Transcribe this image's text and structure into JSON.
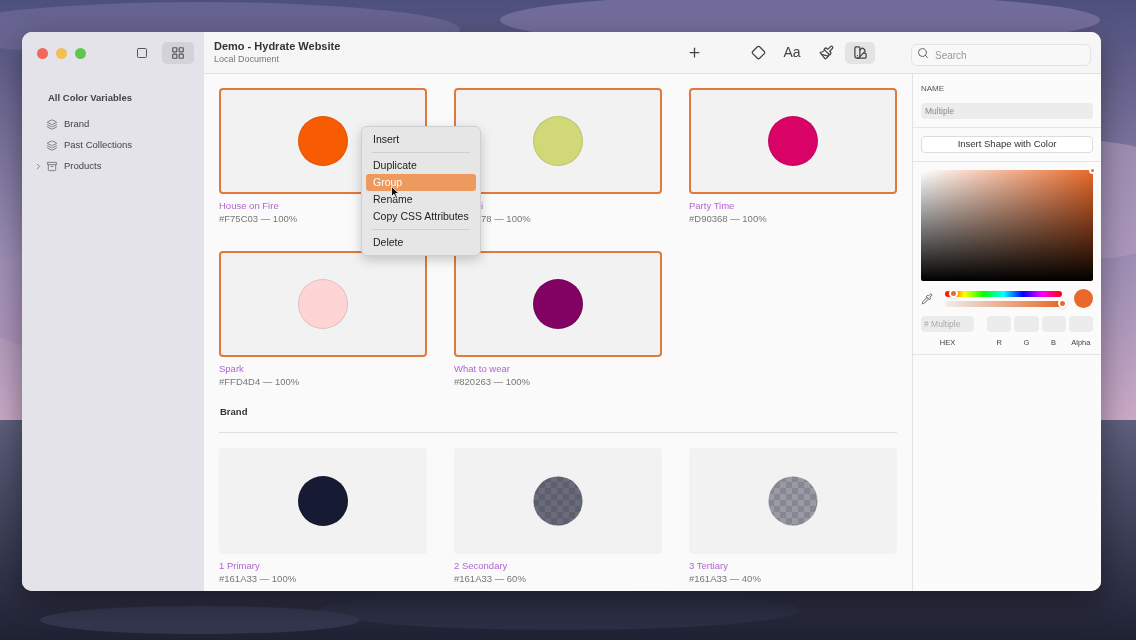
{
  "window": {
    "title": "Demo - Hydrate Website",
    "subtitle": "Local Document"
  },
  "view_toggle": [
    {
      "kind": "single",
      "selected": false
    },
    {
      "kind": "grid",
      "selected": true
    }
  ],
  "sidebar": {
    "heading": "All Color Variables",
    "items": [
      {
        "label": "Brand",
        "kind": "collection"
      },
      {
        "label": "Past Collections",
        "kind": "collection"
      },
      {
        "label": "Products",
        "kind": "folder",
        "expanded": false
      }
    ]
  },
  "toolbar": [
    {
      "kind": "add",
      "selected": false
    },
    {
      "kind": "shape",
      "selected": false
    },
    {
      "kind": "text",
      "label": "Aa",
      "selected": false
    },
    {
      "kind": "brush",
      "selected": false
    },
    {
      "kind": "swatches",
      "selected": true
    }
  ],
  "search": {
    "placeholder": "Search"
  },
  "groups": [
    {
      "swatches": [
        {
          "name": "House on Fire",
          "code": "#F75C03 — 100%",
          "color": "#f75c03",
          "kind": "solid",
          "selected": true,
          "clipped": false
        },
        {
          "name": "i",
          "code": "78 — 100%",
          "color": "#d1d878",
          "kind": "solid",
          "selected": true,
          "clipped": true
        },
        {
          "name": "Party Time",
          "code": "#D90368 — 100%",
          "color": "#d90368",
          "kind": "solid",
          "selected": true,
          "clipped": false
        },
        {
          "name": "Spark",
          "code": "#FFD4D4 — 100%",
          "color": "#ffd4d4",
          "kind": "solid",
          "selected": true,
          "clipped": false
        },
        {
          "name": "What to wear",
          "code": "#820263 — 100%",
          "color": "#820263",
          "kind": "solid",
          "selected": true,
          "clipped": false
        }
      ]
    },
    {
      "heading": "Brand",
      "swatches": [
        {
          "name": "1 Primary",
          "code": "#161A33 — 100%",
          "color": "#161a33",
          "kind": "solid",
          "selected": false,
          "clipped": false
        },
        {
          "name": "2 Secondary",
          "code": "#161A33 — 60%",
          "color": "#6b6c7b",
          "kind": "translucent",
          "selected": false,
          "clipped": false
        },
        {
          "name": "3 Tertiary",
          "code": "#161A33 — 40%",
          "color": "#9a9aa5",
          "kind": "translucent",
          "selected": false,
          "clipped": false
        }
      ]
    }
  ],
  "context_menu": [
    {
      "kind": "item",
      "label": "Insert",
      "selected": false
    },
    {
      "kind": "separator"
    },
    {
      "kind": "item",
      "label": "Duplicate",
      "selected": false
    },
    {
      "kind": "item",
      "label": "Group",
      "selected": true
    },
    {
      "kind": "item",
      "label": "Rename",
      "selected": false
    },
    {
      "kind": "item",
      "label": "Copy CSS Attributes",
      "selected": false
    },
    {
      "kind": "separator"
    },
    {
      "kind": "item",
      "label": "Delete",
      "selected": false
    }
  ],
  "inspector": {
    "name_label": "NAME",
    "name_placeholder": "Multiple",
    "insert_button": "Insert Shape with Color",
    "picker": {
      "color": "#e8692a",
      "hue": {
        "level": 0.07
      },
      "alpha": {
        "level": 1.0
      }
    },
    "hex_placeholder": "# Multiple",
    "fields": [
      "HEX",
      "R",
      "G",
      "B",
      "Alpha"
    ]
  }
}
